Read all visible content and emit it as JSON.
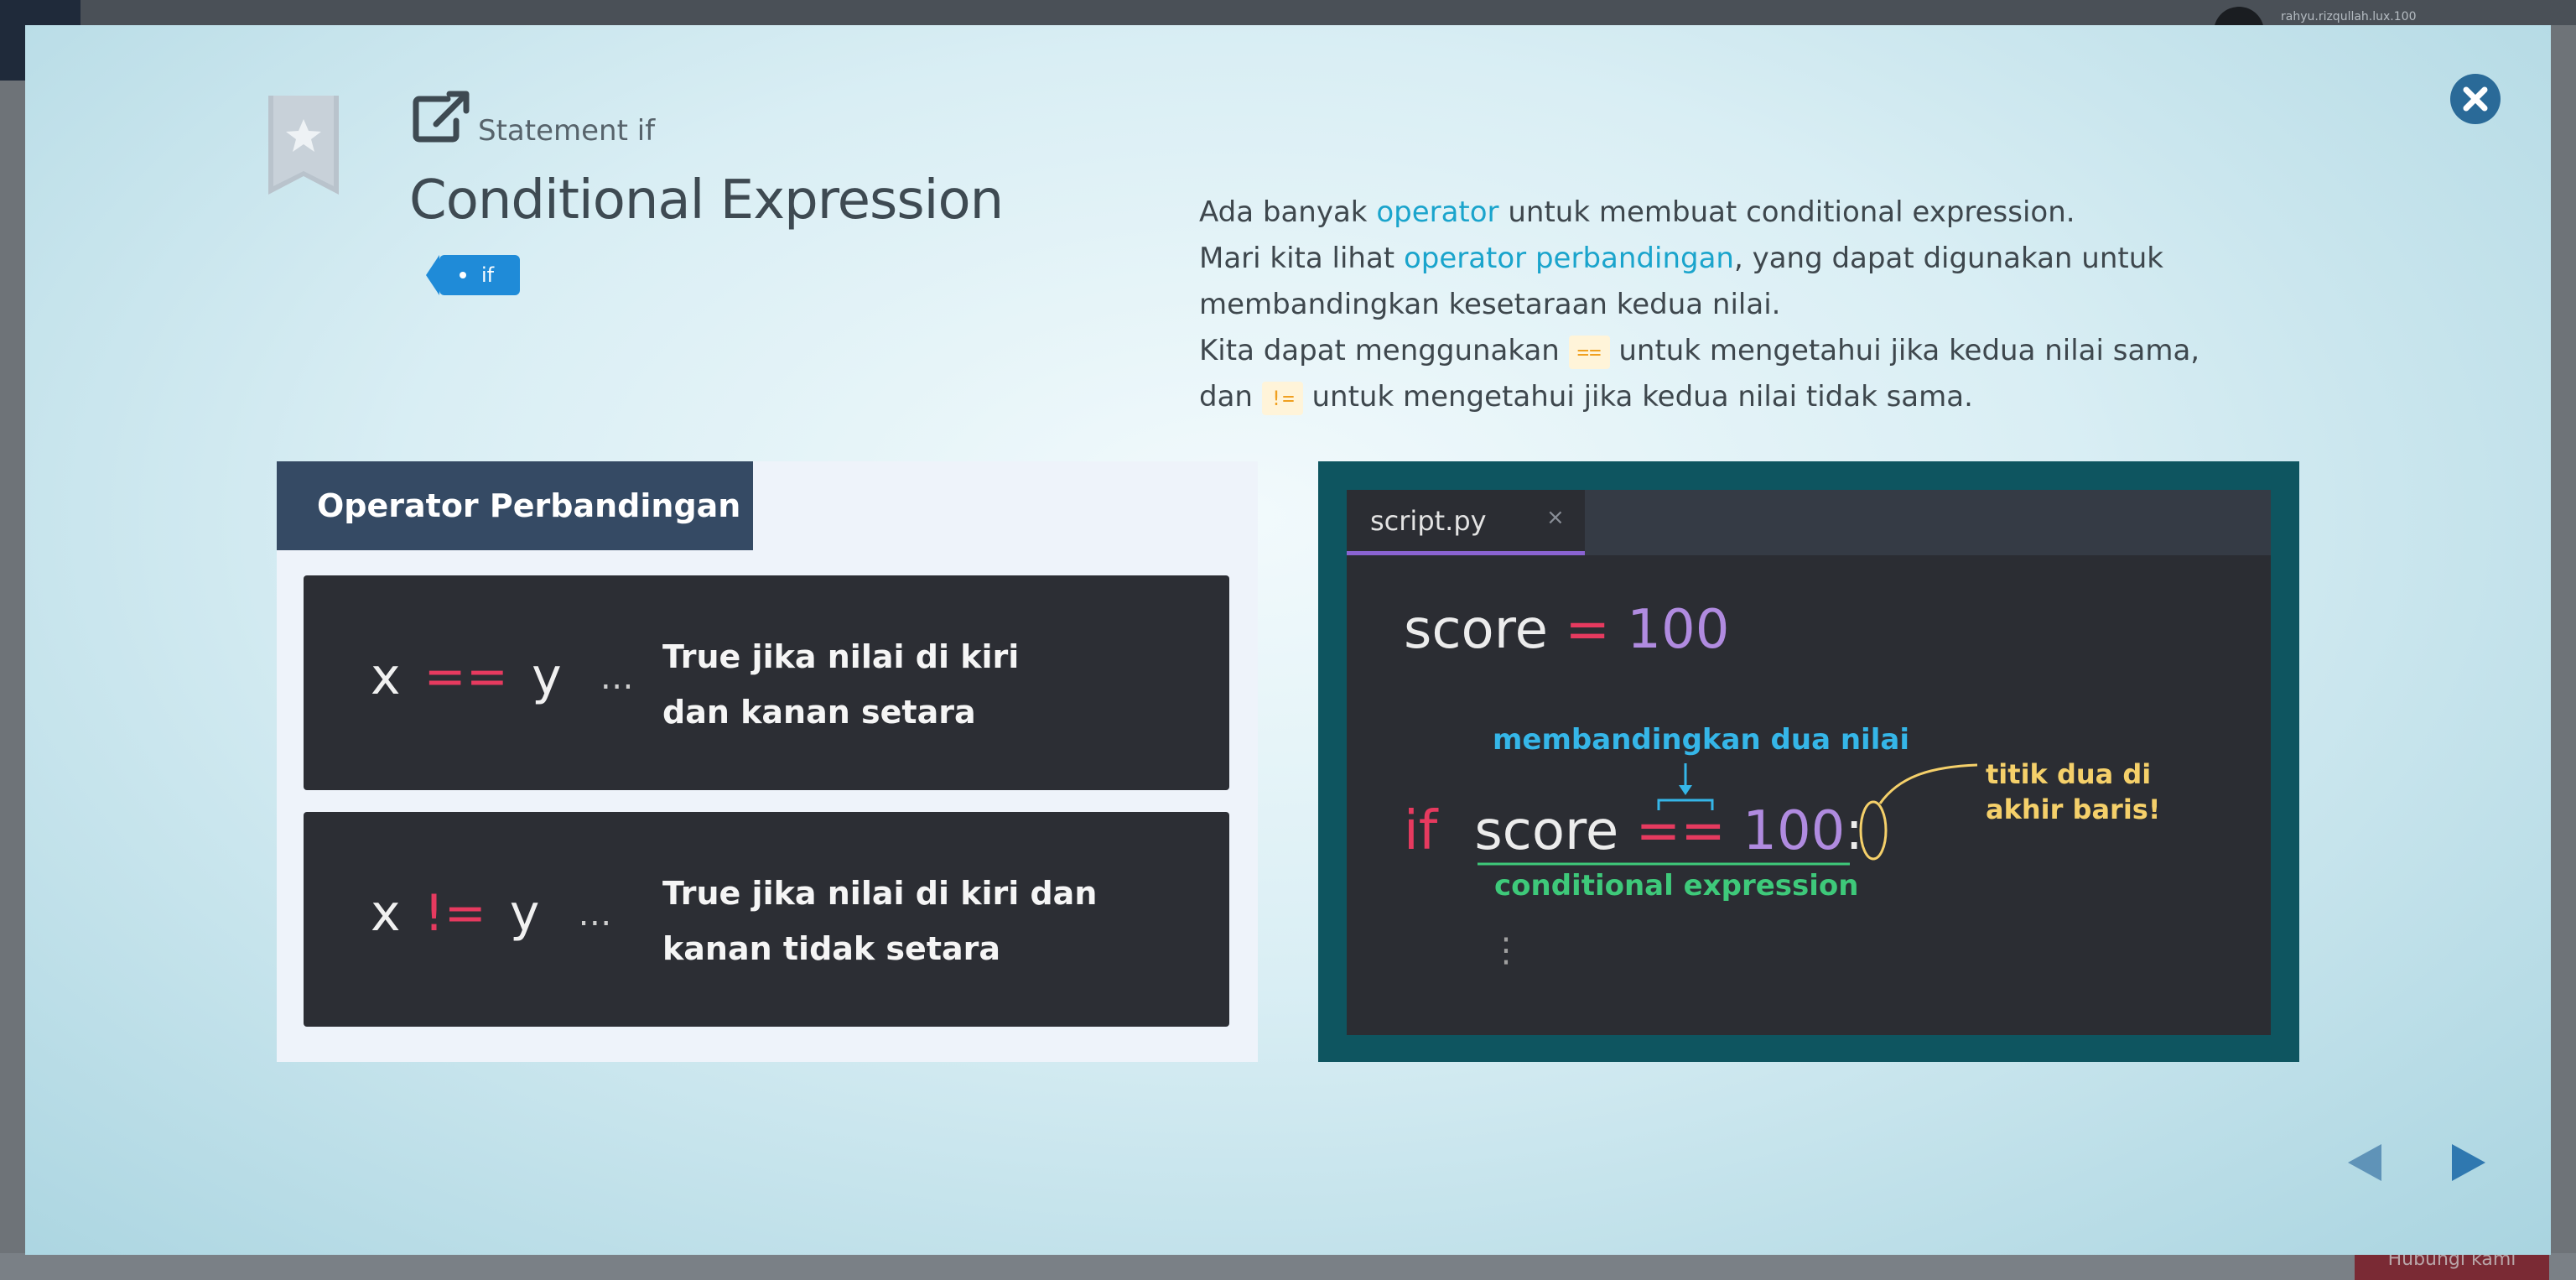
{
  "background": {
    "user_label": "rahyu.rizqullah.lux.100",
    "bottom_button_label": "Hubungi kami"
  },
  "modal": {
    "subtitle": "Statement if",
    "title": "Conditional Expression",
    "tag": "if",
    "description": {
      "l1_a": "Ada banyak ",
      "l1_link": "operator",
      "l1_b": " untuk membuat conditional expression.",
      "l2_a": "Mari kita lihat ",
      "l2_link": "operator perbandingan",
      "l2_b": ", yang dapat digunakan untuk membandingkan kesetaraan kedua nilai.",
      "l3_a": "Kita dapat menggunakan ",
      "l3_code": "==",
      "l3_b": " untuk mengetahui jika kedua nilai sama,",
      "l4_a": "dan ",
      "l4_code": "!=",
      "l4_b": " untuk mengetahui jika kedua nilai tidak sama."
    },
    "operator_panel": {
      "header": "Operator Perbandingan",
      "items": [
        {
          "left": "x",
          "op": "==",
          "right": "y",
          "dots": "…",
          "desc_l1": "True jika nilai di kiri",
          "desc_l2": "dan kanan setara"
        },
        {
          "left": "x",
          "op": "!=",
          "right": "y",
          "dots": "…",
          "desc_l1": "True jika nilai di kiri dan",
          "desc_l2": "kanan tidak setara"
        }
      ]
    },
    "code_panel": {
      "tab": "script.py",
      "tab_close": "×",
      "line1": {
        "var": "score ",
        "eq": "=",
        "num": " 100"
      },
      "line2": {
        "kw": "if",
        "var": "score ",
        "op": "==",
        "num": " 100",
        "colon": ":"
      },
      "annotation_compare": "membandingkan dua nilai",
      "annotation_expression": "conditional expression",
      "annotation_colon_l1": "titik dua di",
      "annotation_colon_l2": "akhir baris!",
      "continuation": "⋮"
    }
  },
  "colors": {
    "accent_blue": "#1aa4cc",
    "operator_red": "#e63a5f",
    "number_purple": "#b08be0",
    "annotation_green": "#3ec97a",
    "annotation_yellow": "#f5d06a"
  }
}
